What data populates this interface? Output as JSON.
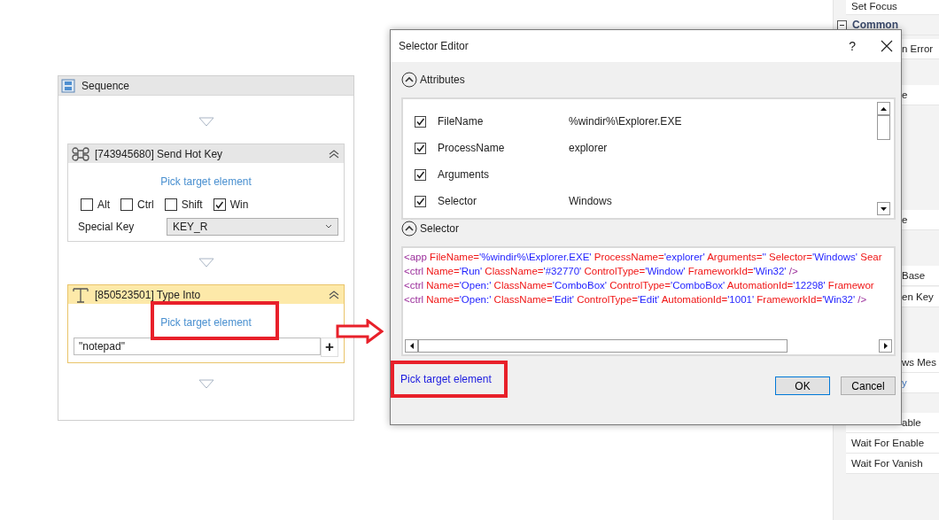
{
  "sequence": {
    "title": "Sequence",
    "activities": [
      {
        "kind": "hotkey",
        "title": "[743945680] Send Hot Key",
        "selected": false,
        "link": "Pick target element",
        "modifiers": [
          {
            "label": "Alt",
            "checked": false
          },
          {
            "label": "Ctrl",
            "checked": false
          },
          {
            "label": "Shift",
            "checked": false
          },
          {
            "label": "Win",
            "checked": true
          }
        ],
        "special_key_label": "Special Key",
        "special_key": "KEY_R"
      },
      {
        "kind": "type_into",
        "title": "[850523501] Type Into",
        "selected": true,
        "link": "Pick target element",
        "text": "\"notepad\"",
        "add_button": "+"
      }
    ]
  },
  "panel": {
    "items": [
      {
        "kind": "item",
        "text": "Set Focus"
      },
      {
        "kind": "category",
        "text": "Common",
        "expanded": true
      },
      {
        "kind": "clipped",
        "text": "n Error"
      },
      {
        "kind": "clipped",
        "text": "e"
      },
      {
        "kind": "clipped",
        "text": "e"
      },
      {
        "kind": "clipped",
        "text": "Base"
      },
      {
        "kind": "clipped",
        "text": "en Key"
      },
      {
        "kind": "clipped",
        "text": "ws Mes"
      },
      {
        "kind": "clipped_link",
        "text": "y"
      },
      {
        "kind": "clipped",
        "text": "able"
      },
      {
        "kind": "item",
        "text": "Wait For Enable"
      },
      {
        "kind": "item",
        "text": "Wait For Vanish"
      }
    ]
  },
  "dialog": {
    "title": "Selector Editor",
    "help": "?",
    "attributes": {
      "title": "Attributes",
      "expanded": true,
      "rows": [
        {
          "checked": true,
          "name": "FileName",
          "value": "%windir%\\Explorer.EXE"
        },
        {
          "checked": true,
          "name": "ProcessName",
          "value": "explorer"
        },
        {
          "checked": true,
          "name": "Arguments"
        },
        {
          "checked": true,
          "name": "Selector",
          "value": "Windows"
        }
      ]
    },
    "selector": {
      "title": "Selector",
      "expanded": true,
      "lines": [
        [
          {
            "kind": "tag",
            "text": "<app"
          },
          {
            "kind": "attr",
            "text": "FileName="
          },
          {
            "kind": "value",
            "text": "'%windir%\\Explorer.EXE'"
          },
          {
            "kind": "attr",
            "text": "ProcessName="
          },
          {
            "kind": "value",
            "text": "'explorer'"
          },
          {
            "kind": "attr",
            "text": "Arguments="
          },
          {
            "kind": "value",
            "text": "''"
          },
          {
            "kind": "attr",
            "text": "Selector="
          },
          {
            "kind": "value",
            "text": "'Windows'"
          },
          {
            "kind": "attr",
            "text": "Sear"
          }
        ],
        [
          {
            "kind": "tag",
            "text": "<ctrl"
          },
          {
            "kind": "attr",
            "text": "Name="
          },
          {
            "kind": "value",
            "text": "'Run'"
          },
          {
            "kind": "attr",
            "text": "ClassName="
          },
          {
            "kind": "value",
            "text": "'#32770'"
          },
          {
            "kind": "attr",
            "text": "ControlType="
          },
          {
            "kind": "value",
            "text": "'Window'"
          },
          {
            "kind": "attr",
            "text": "FrameworkId="
          },
          {
            "kind": "value",
            "text": "'Win32'"
          },
          {
            "kind": "tag",
            "text": "/>"
          }
        ],
        [
          {
            "kind": "tag",
            "text": "<ctrl"
          },
          {
            "kind": "attr",
            "text": "Name="
          },
          {
            "kind": "value",
            "text": "'Open:'"
          },
          {
            "kind": "attr",
            "text": "ClassName="
          },
          {
            "kind": "value",
            "text": "'ComboBox'"
          },
          {
            "kind": "attr",
            "text": "ControlType="
          },
          {
            "kind": "value",
            "text": "'ComboBox'"
          },
          {
            "kind": "attr",
            "text": "AutomationId="
          },
          {
            "kind": "value",
            "text": "'12298'"
          },
          {
            "kind": "attr",
            "text": "Framewor"
          }
        ],
        [
          {
            "kind": "tag",
            "text": "<ctrl"
          },
          {
            "kind": "attr",
            "text": "Name="
          },
          {
            "kind": "value",
            "text": "'Open:'"
          },
          {
            "kind": "attr",
            "text": "ClassName="
          },
          {
            "kind": "value",
            "text": "'Edit'"
          },
          {
            "kind": "attr",
            "text": "ControlType="
          },
          {
            "kind": "value",
            "text": "'Edit'"
          },
          {
            "kind": "attr",
            "text": "AutomationId="
          },
          {
            "kind": "value",
            "text": "'1001'"
          },
          {
            "kind": "attr",
            "text": "FrameworkId="
          },
          {
            "kind": "value",
            "text": "'Win32'"
          },
          {
            "kind": "tag",
            "text": "/>"
          }
        ]
      ]
    },
    "link": "Pick target element",
    "buttons": [
      {
        "label": "OK",
        "default": true
      },
      {
        "label": "Cancel",
        "default": false
      }
    ]
  }
}
